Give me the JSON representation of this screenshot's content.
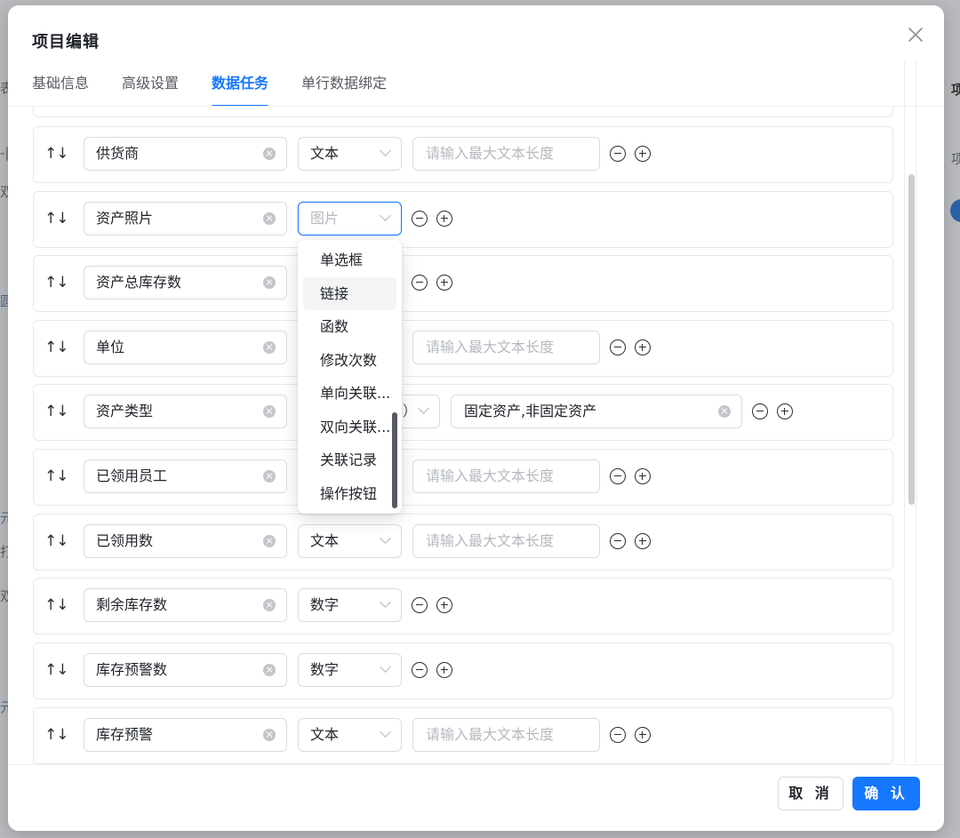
{
  "modal": {
    "title": "项目编辑",
    "confirm_label": "确 认",
    "cancel_label": "取 消"
  },
  "tabs": [
    {
      "label": "基础信息",
      "active": false
    },
    {
      "label": "高级设置",
      "active": false
    },
    {
      "label": "数据任务",
      "active": true
    },
    {
      "label": "单行数据绑定",
      "active": false
    }
  ],
  "sort_label": "↑↓",
  "rows": [
    {
      "name": "供货商",
      "type": "文本",
      "length_placeholder": "请输入最大文本长度"
    },
    {
      "name": "资产照片",
      "type_placeholder": "图片"
    },
    {
      "name": "资产总库存数"
    },
    {
      "name": "单位",
      "length_placeholder": "请输入最大文本长度"
    },
    {
      "name": "资产类型",
      "type_partial": "）",
      "options_value": "固定资产,非固定资产"
    },
    {
      "name": "已领用员工",
      "length_placeholder": "请输入最大文本长度"
    },
    {
      "name": "已领用数",
      "type": "文本",
      "length_placeholder": "请输入最大文本长度"
    },
    {
      "name": "剩余库存数",
      "type": "数字"
    },
    {
      "name": "库存预警数",
      "type": "数字"
    },
    {
      "name": "库存预警",
      "type": "文本",
      "length_placeholder": "请输入最大文本长度"
    }
  ],
  "dropdown": {
    "items": [
      "单选框",
      "链接",
      "函数",
      "修改次数",
      "单向关联...",
      "双向关联...",
      "关联记录",
      "操作按钮"
    ],
    "hovered_index": 1
  },
  "colors": {
    "accent": "#1677ff",
    "border": "#d9dce0",
    "placeholder": "#b5b9bf"
  },
  "background": {
    "fragments": [
      "表",
      "-|",
      "项",
      "项",
      "双",
      "圆",
      "元",
      "打",
      "双",
      "元"
    ]
  }
}
